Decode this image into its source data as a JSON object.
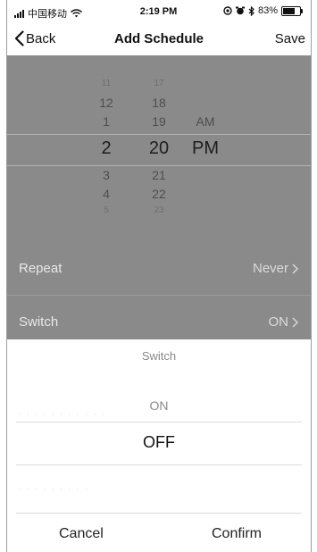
{
  "status_bar": {
    "carrier": "中国移动",
    "time": "2:19 PM",
    "battery": "83%",
    "battery_level": 0.83,
    "icons": [
      "signal-icon",
      "wifi-icon",
      "location-icon",
      "alarm-icon",
      "bluetooth-icon",
      "battery-icon"
    ]
  },
  "nav": {
    "back_label": "Back",
    "title": "Add Schedule",
    "save_label": "Save"
  },
  "time_picker": {
    "hour_column": [
      {
        "value": "11",
        "state": "far"
      },
      {
        "value": "12",
        "state": "near"
      },
      {
        "value": "1",
        "state": "near"
      },
      {
        "value": "2",
        "state": "selected"
      },
      {
        "value": "3",
        "state": "near"
      },
      {
        "value": "4",
        "state": "near"
      },
      {
        "value": "5",
        "state": "far"
      }
    ],
    "minute_column": [
      {
        "value": "17",
        "state": "far"
      },
      {
        "value": "18",
        "state": "near"
      },
      {
        "value": "19",
        "state": "near"
      },
      {
        "value": "20",
        "state": "selected"
      },
      {
        "value": "21",
        "state": "near"
      },
      {
        "value": "22",
        "state": "near"
      },
      {
        "value": "23",
        "state": "far"
      }
    ],
    "ampm_column": [
      {
        "value": "AM",
        "state": "near"
      },
      {
        "value": "PM",
        "state": "selected"
      }
    ]
  },
  "settings_rows": [
    {
      "label": "Repeat",
      "value": "Never"
    },
    {
      "label": "Switch",
      "value": "ON"
    }
  ],
  "action_sheet": {
    "title": "Switch",
    "options": [
      {
        "label": "ON",
        "selected": false
      },
      {
        "label": "OFF",
        "selected": true
      }
    ],
    "cancel_label": "Cancel",
    "confirm_label": "Confirm"
  },
  "colors": {
    "overlay": "#8a8a8a",
    "sheet_background": "#ffffff",
    "text_primary": "#111111"
  }
}
